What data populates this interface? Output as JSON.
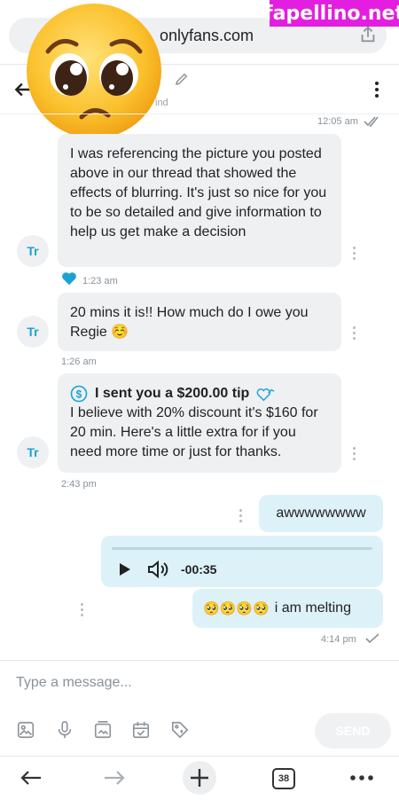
{
  "browser": {
    "url": "onlyfans.com",
    "watermark": "fapellino.net",
    "tabs_count": "38"
  },
  "header": {
    "subtitle": "ind"
  },
  "thread": {
    "top_time": "12:05 am",
    "messages": [
      {
        "sender": "Tr",
        "text": "I was referencing the picture you posted above in our thread that showed the effects of blurring. It's just so nice for you to be so detailed and give information to help us get make a decision",
        "time": "1:23 am",
        "liked": true
      },
      {
        "sender": "Tr",
        "text": "20 mins it is!! How much do I owe you Regie ☺️",
        "time": "1:26 am"
      },
      {
        "sender": "Tr",
        "tip": "I sent you a $200.00 tip",
        "text": "I believe with 20% discount it's $160 for 20 min. Here's a little extra for if you need more time or just for thanks.",
        "time": "2:43 pm"
      }
    ],
    "outgoing": {
      "text1": "awwwwwwww",
      "audio_time": "-00:35",
      "text2": "i am melting",
      "emoji": "🥺🥺🥺🥺",
      "time": "4:14 pm"
    }
  },
  "composer": {
    "placeholder": "Type a message...",
    "send_label": "SEND"
  },
  "colors": {
    "accent": "#00aff0",
    "incoming_bg": "#eef0f2",
    "outgoing_bg": "#ddf1f8"
  }
}
